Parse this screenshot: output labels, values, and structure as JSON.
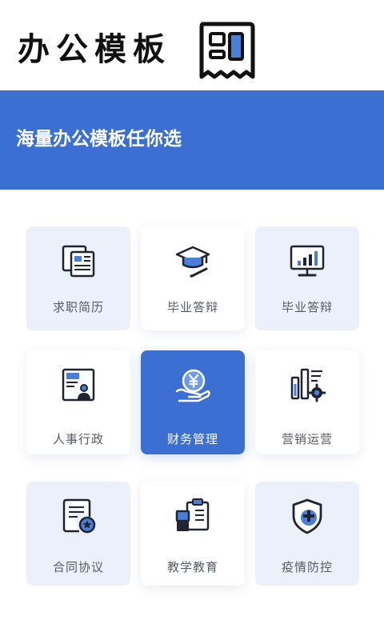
{
  "header": {
    "title": "办公模板",
    "icon": "template-doc-icon"
  },
  "banner": {
    "text": "海量办公模板任你选"
  },
  "colors": {
    "accent": "#3b6fd1",
    "card_light": "#ebf0fb",
    "icon_dark": "#1f2430",
    "label_text": "#555a66"
  },
  "categories": [
    {
      "label": "求职简历",
      "icon": "resume-documents-icon",
      "style": "light"
    },
    {
      "label": "毕业答辩",
      "icon": "graduation-cap-icon",
      "style": "white"
    },
    {
      "label": "毕业答辩",
      "icon": "presentation-chart-icon",
      "style": "light"
    },
    {
      "label": "人事行政",
      "icon": "id-card-icon",
      "style": "white"
    },
    {
      "label": "财务管理",
      "icon": "yuan-coin-hand-icon",
      "style": "active"
    },
    {
      "label": "营销运营",
      "icon": "marketing-bars-gear-icon",
      "style": "white"
    },
    {
      "label": "合同协议",
      "icon": "contract-seal-icon",
      "style": "light"
    },
    {
      "label": "教学教育",
      "icon": "clipboard-books-icon",
      "style": "white"
    },
    {
      "label": "疫情防控",
      "icon": "medical-shield-icon",
      "style": "light"
    }
  ]
}
